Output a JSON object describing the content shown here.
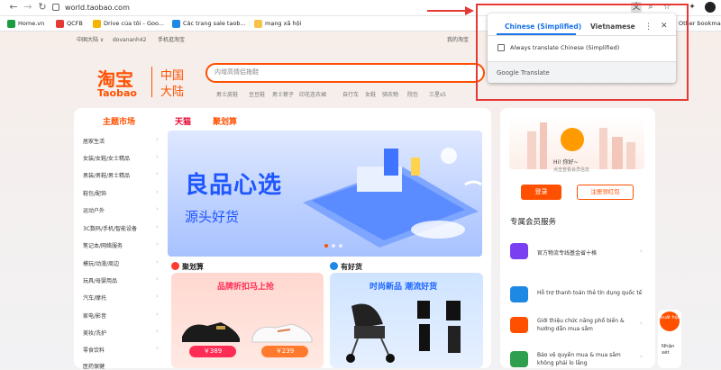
{
  "browser": {
    "url": "world.taobao.com",
    "bookmarks": [
      {
        "label": "Home.vn",
        "color": "#1a9c3f"
      },
      {
        "label": "QCFB",
        "color": "#e53935"
      },
      {
        "label": "Drive của tôi - Goo...",
        "color": "#f4b400"
      },
      {
        "label": "Các trang sale taob...",
        "color": "#1e88e5"
      },
      {
        "label": "mạng xã hội",
        "color": "#f6c24a"
      }
    ],
    "other_bookmarks": "Other bookma"
  },
  "topnav": {
    "region": "中国大陆 ∨",
    "user": "dovananh42",
    "mobile": "手机逛淘宝",
    "my_taobao": "我的淘宝"
  },
  "logo": {
    "cn": "淘宝",
    "en": "Taobao",
    "region_line1": "中国",
    "region_line2": "大陆"
  },
  "search": {
    "placeholder": "内增高情侣拖鞋",
    "hot": [
      "男士皮鞋",
      "豆豆鞋",
      "男士裤子",
      "印花连衣裙",
      "自行车",
      "女鞋",
      "骑衣物",
      "院包",
      "三星s5"
    ]
  },
  "tabs": {
    "market": "主题市场",
    "tmall": "天猫",
    "juhuasuan": "聚划算"
  },
  "categories": [
    "居家生活",
    "女装/女鞋/女士精品",
    "男装/男鞋/男士精品",
    "鞋包/配饰",
    "运动户外",
    "3C数码/手机/智能设备",
    "笔记本/网络服务",
    "模玩/动漫/周边",
    "玩具/母婴用品",
    "汽车/摩托",
    "家电/影音",
    "美妆/洗护",
    "零食饮料",
    "医药保健"
  ],
  "banner": {
    "headline": "良品心选",
    "subline": "源头好货"
  },
  "sections": {
    "left": {
      "title": "聚划算",
      "card_title": "品牌折扣马上抢",
      "prices": [
        "￥389",
        "￥239"
      ]
    },
    "right": {
      "title": "有好货",
      "card_title": "时尚新品 潮流好货"
    }
  },
  "user_panel": {
    "greeting": "Hi! 你好~",
    "member_label": "点击查看会员信息",
    "login": "登录",
    "register": "注册领红包",
    "member_title": "专属会员服务",
    "services": [
      {
        "text": "官方物流专线基金省十格",
        "color": "#7b3ff2"
      },
      {
        "text": "Hỗ trợ thanh toán thẻ tín dụng quốc tế",
        "color": "#1e88e5"
      },
      {
        "text": "Giới thiệu chức năng phổ biến & hướng dẫn mua sắm",
        "color": "#ff5000"
      },
      {
        "text": "Bảo vệ quyền mua & mua sắm không phải lo lắng",
        "color": "#2e9e4f"
      }
    ]
  },
  "float_badge": {
    "top": "xuất hội",
    "text": "Nhận xét"
  },
  "translate": {
    "tab_source": "Chinese (Simplified)",
    "tab_target": "Vietnamese",
    "always": "Always translate Chinese (Simplified)",
    "footer": "Google Translate",
    "more": "⋮",
    "close": "✕"
  },
  "colors": {
    "accent": "#ff5000",
    "banner_text": "#1f57ff",
    "annotation": "#e53935",
    "translate_blue": "#1a73e8"
  }
}
